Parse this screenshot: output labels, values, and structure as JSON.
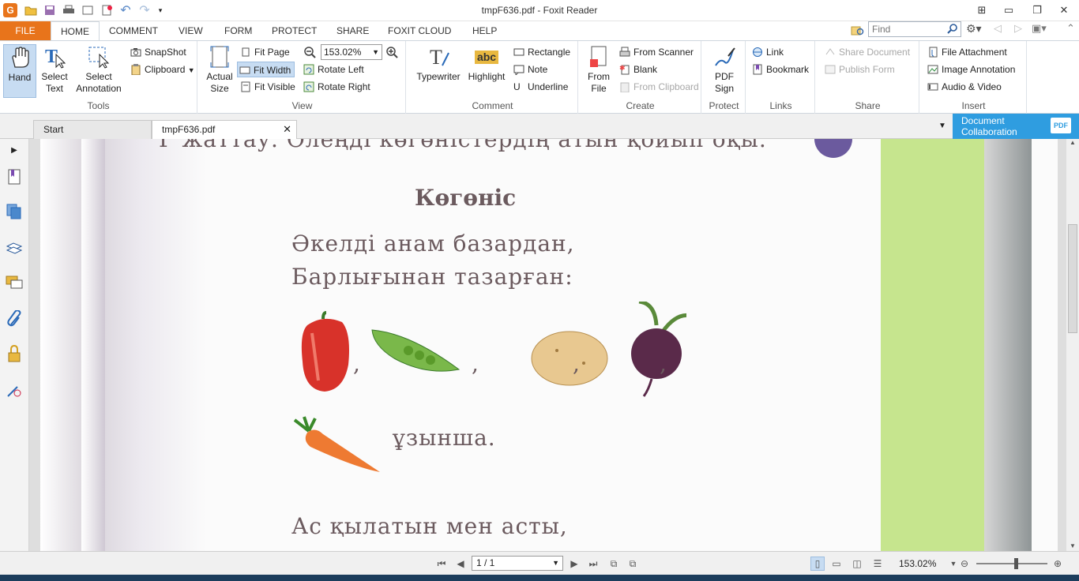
{
  "window": {
    "title": "tmpF636.pdf - Foxit Reader"
  },
  "ribbon_tabs": [
    "FILE",
    "HOME",
    "COMMENT",
    "VIEW",
    "FORM",
    "PROTECT",
    "SHARE",
    "FOXIT CLOUD",
    "HELP"
  ],
  "find": {
    "placeholder": "Find"
  },
  "tools": {
    "hand": "Hand",
    "select_text": "Select\nText",
    "select_annotation": "Select\nAnnotation",
    "snapshot": "SnapShot",
    "clipboard": "Clipboard",
    "label": "Tools"
  },
  "view": {
    "actual_size": "Actual\nSize",
    "fit_page": "Fit Page",
    "fit_width": "Fit Width",
    "fit_visible": "Fit Visible",
    "zoom": "153.02%",
    "rotate_left": "Rotate Left",
    "rotate_right": "Rotate Right",
    "label": "View"
  },
  "comment": {
    "typewriter": "Typewriter",
    "highlight": "Highlight",
    "highlight_icon_text": "abc",
    "rectangle": "Rectangle",
    "note": "Note",
    "underline": "Underline",
    "label": "Comment"
  },
  "create": {
    "from_file": "From\nFile",
    "from_scanner": "From Scanner",
    "blank": "Blank",
    "from_clipboard": "From Clipboard",
    "label": "Create"
  },
  "protect": {
    "pdf_sign": "PDF\nSign",
    "label": "Protect"
  },
  "links": {
    "link": "Link",
    "bookmark": "Bookmark",
    "label": "Links"
  },
  "share": {
    "share_document": "Share Document",
    "publish_form": "Publish Form",
    "label": "Share"
  },
  "insert": {
    "file_attachment": "File Attachment",
    "image_annotation": "Image Annotation",
    "audio_video": "Audio & Video",
    "label": "Insert"
  },
  "doc_tabs": {
    "start": "Start",
    "current": "tmpF636.pdf"
  },
  "collab": {
    "line1": "Document",
    "line2": "Collaboration",
    "badge": "PDF"
  },
  "document": {
    "top_line": "Ғ жаттау. Өлеңді көгөністердің атын қойып оқы.",
    "title": "Көгөніс",
    "line1": "Әкелді анам базардан,",
    "line2": "Барлығынан тазарған:",
    "comma": ",",
    "line3": "ұзынша.",
    "line4": "Ас қылатын мен асты,"
  },
  "status": {
    "page": "1 / 1",
    "zoom": "153.02%"
  },
  "colors": {
    "accent": "#e8741b",
    "collab": "#2f9de0",
    "selected": "#c7dcf2"
  }
}
